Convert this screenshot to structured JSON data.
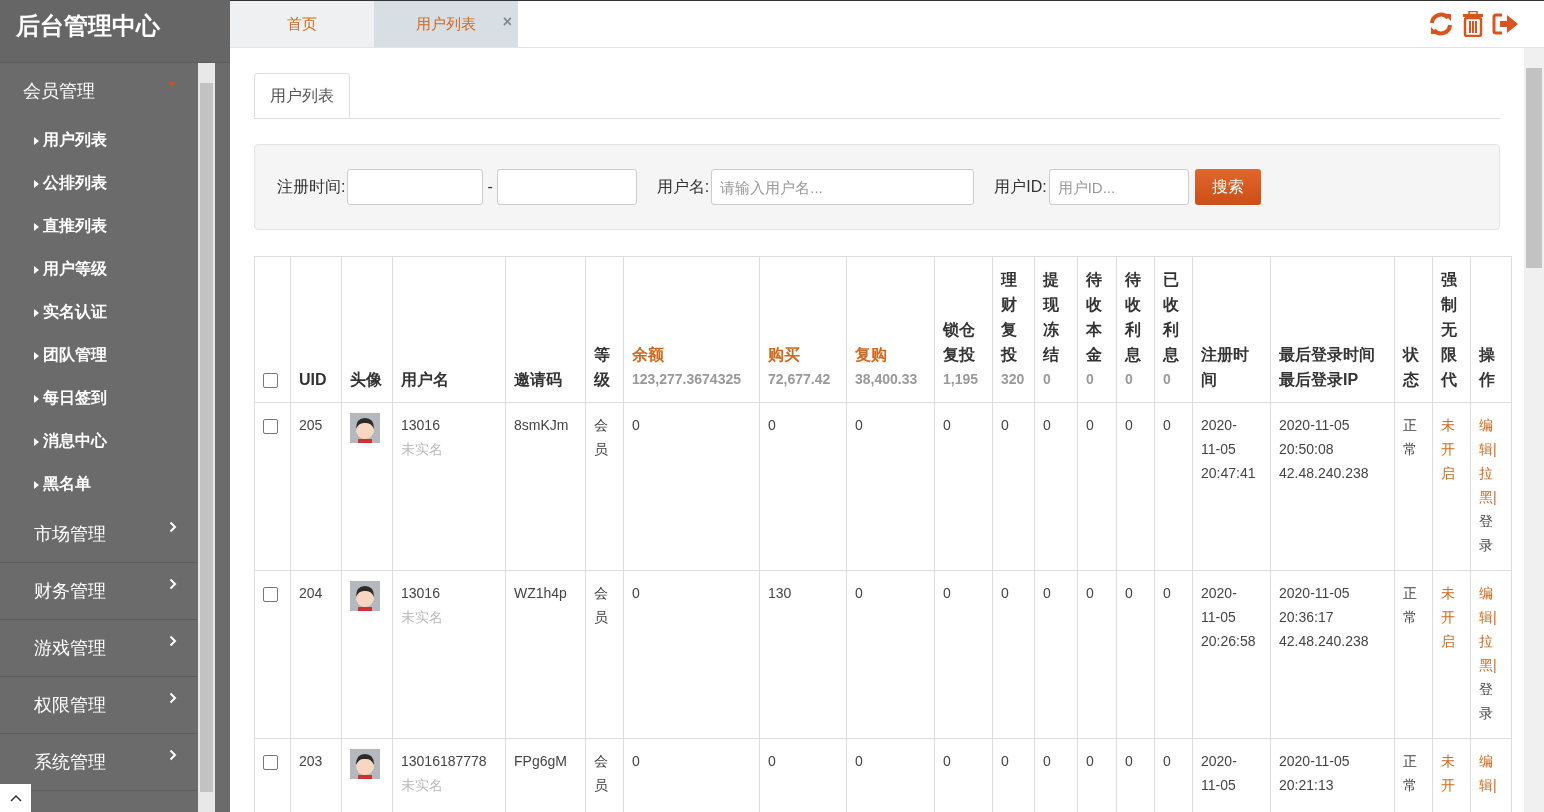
{
  "sidebar": {
    "title": "后台管理中心",
    "groups": [
      {
        "label": "会员管理",
        "expanded": true,
        "children": [
          "用户列表",
          "公排列表",
          "直推列表",
          "用户等级",
          "实名认证",
          "团队管理",
          "每日签到",
          "消息中心",
          "黑名单"
        ]
      },
      {
        "label": "市场管理",
        "expanded": false
      },
      {
        "label": "财务管理",
        "expanded": false
      },
      {
        "label": "游戏管理",
        "expanded": false
      },
      {
        "label": "权限管理",
        "expanded": false
      },
      {
        "label": "系统管理",
        "expanded": false
      }
    ]
  },
  "tabs": [
    {
      "label": "首页",
      "selected": false
    },
    {
      "label": "用户列表",
      "selected": true,
      "close": "×"
    }
  ],
  "panel_tab": "用户列表",
  "search": {
    "fields": [
      {
        "kind": "daterange",
        "label": "注册时间:",
        "separator": "-"
      },
      {
        "kind": "text",
        "label": "用户名:",
        "placeholder": "请输入用户名..."
      },
      {
        "kind": "text",
        "label": "用户ID:",
        "placeholder": "用户ID..."
      }
    ],
    "button": "搜索"
  },
  "table": {
    "columns": [
      {
        "kind": "checkbox",
        "checked": false
      },
      {
        "title": "UID"
      },
      {
        "title": "头像"
      },
      {
        "title": "用户名"
      },
      {
        "title": "邀请码"
      },
      {
        "title": "等级"
      },
      {
        "title": "余额",
        "highlight": true,
        "total": "123,277.3674325"
      },
      {
        "title": "购买",
        "highlight": true,
        "total": "72,677.42"
      },
      {
        "title": "复购",
        "highlight": true,
        "total": "38,400.33"
      },
      {
        "title": "锁仓复投",
        "total": "1,195"
      },
      {
        "title": "理财复投",
        "total": "320"
      },
      {
        "title": "提现冻结",
        "total": "0"
      },
      {
        "title": "待收本金",
        "total": "0"
      },
      {
        "title": "待收利息",
        "total": "0"
      },
      {
        "title": "已收利息",
        "total": "0"
      },
      {
        "title": "注册时间"
      },
      {
        "title": "最后登录时间",
        "subtitle": "最后登录IP"
      },
      {
        "title": "状态"
      },
      {
        "title": "强制无限代"
      },
      {
        "title": "操作"
      }
    ],
    "rows": [
      {
        "checked": false,
        "uid": "205",
        "username": "13016",
        "realname": "未实名",
        "invite": "8smKJm",
        "level": "会员",
        "values": [
          "0",
          "0",
          "0",
          "0",
          "0",
          "0",
          "0",
          "0",
          "0"
        ],
        "reg_time": [
          "2020-",
          "11-05",
          "20:47:41"
        ],
        "last_login": [
          "2020-11-05",
          "20:50:08"
        ],
        "ip": "42.48.240.238",
        "status": "正常",
        "force": "未开启",
        "actions": [
          {
            "label": "编辑|",
            "kind": "edit"
          },
          {
            "label": "拉黑|",
            "kind": "block"
          },
          {
            "label": "登录",
            "kind": "login"
          }
        ]
      },
      {
        "checked": false,
        "uid": "204",
        "username": "13016",
        "realname": "未实名",
        "invite": "WZ1h4p",
        "level": "会员",
        "values": [
          "0",
          "130",
          "0",
          "0",
          "0",
          "0",
          "0",
          "0",
          "0"
        ],
        "reg_time": [
          "2020-",
          "11-05",
          "20:26:58"
        ],
        "last_login": [
          "2020-11-05",
          "20:36:17"
        ],
        "ip": "42.48.240.238",
        "status": "正常",
        "force": "未开启",
        "actions": [
          {
            "label": "编辑|",
            "kind": "edit"
          },
          {
            "label": "拉黑|",
            "kind": "block"
          },
          {
            "label": "登录",
            "kind": "login"
          }
        ]
      },
      {
        "checked": false,
        "uid": "203",
        "username": "13016187778",
        "realname": "未实名",
        "invite": "FPg6gM",
        "level": "会员",
        "values": [
          "0",
          "0",
          "0",
          "0",
          "0",
          "0",
          "0",
          "0",
          "0"
        ],
        "reg_time": [
          "2020-",
          "11-05"
        ],
        "last_login": [
          "2020-11-05",
          "20:21:13"
        ],
        "status": "正常",
        "force": "未开",
        "actions": [
          {
            "label": "编辑|",
            "kind": "edit"
          }
        ]
      }
    ]
  }
}
